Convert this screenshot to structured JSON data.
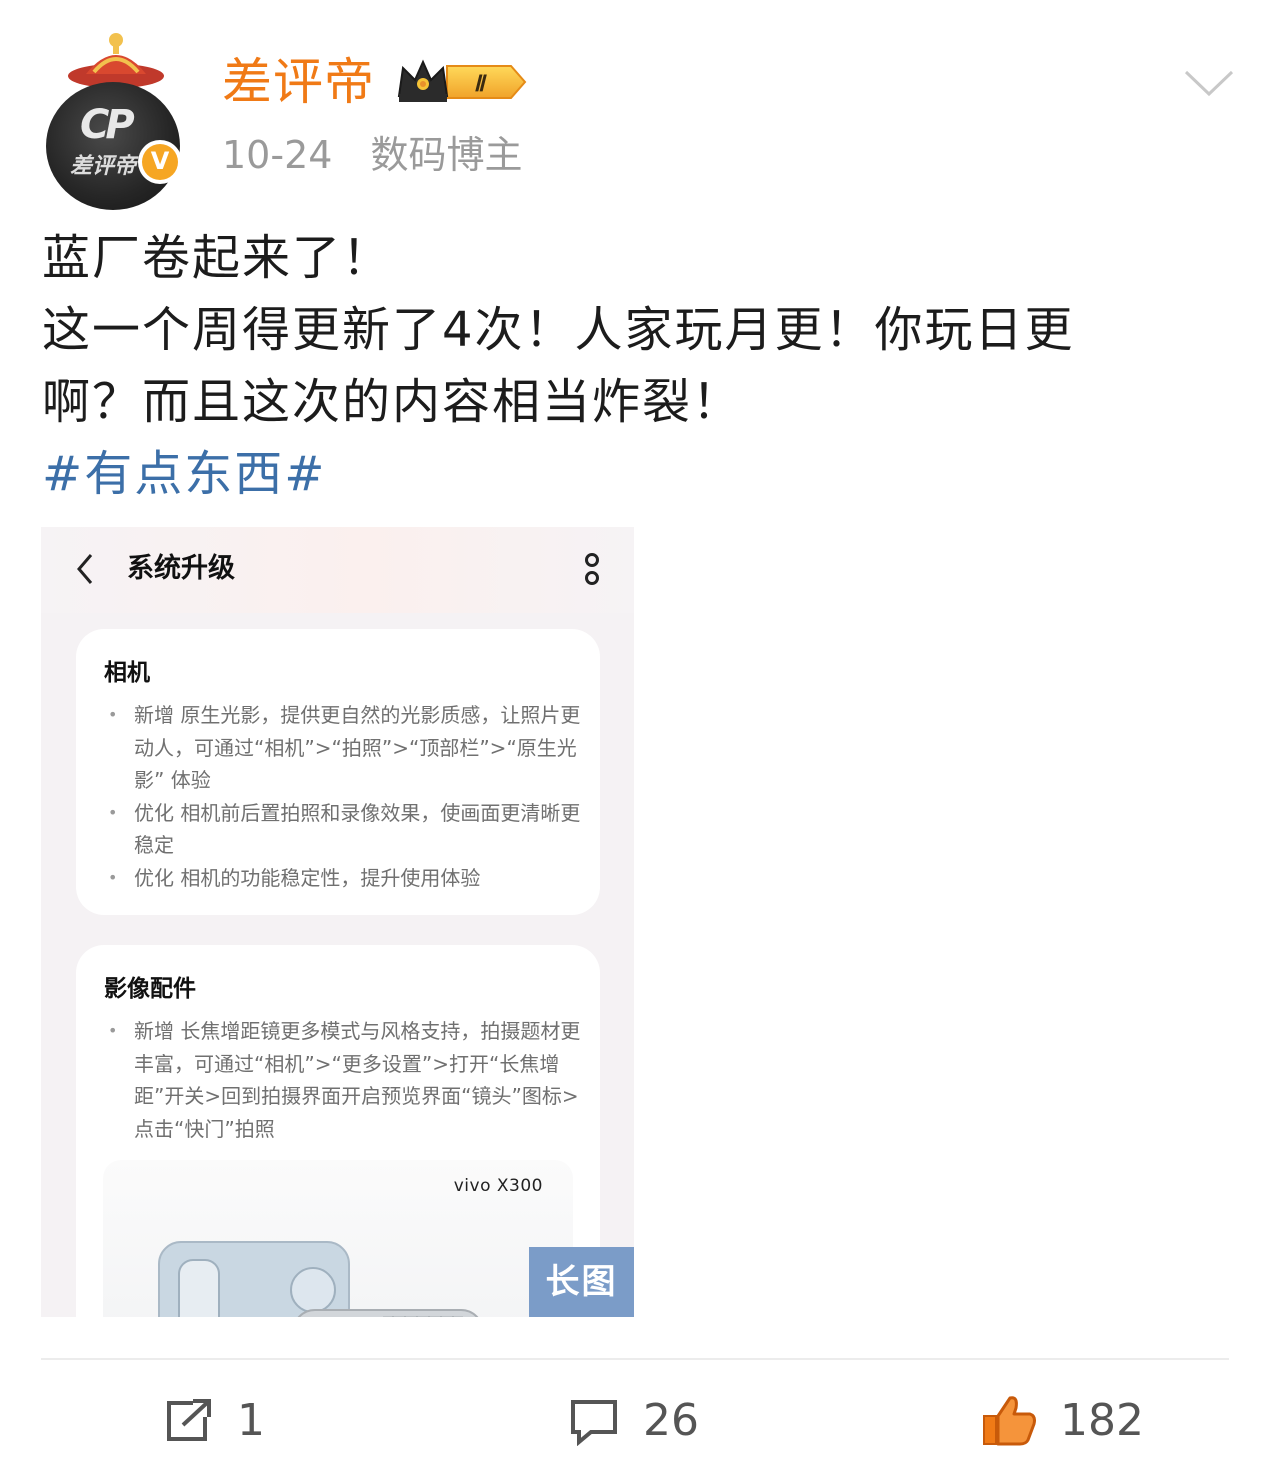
{
  "post": {
    "author": {
      "name": "差评帝",
      "level_badge": "Ⅱ",
      "verified_badge": "V",
      "avatar_logo": "CP",
      "avatar_text": "差评帝"
    },
    "time": "10-24",
    "source": "数码博主",
    "text_lines": [
      "蓝厂卷起来了！",
      "这一个周得更新了4次！人家玩月更！你玩日更",
      "啊？而且这次的内容相当炸裂！"
    ],
    "hashtag": "#有点东西#"
  },
  "media": {
    "screen_title": "系统升级",
    "sections": [
      {
        "title": "相机",
        "items": [
          "新增 原生光影，提供更自然的光影质感，让照片更动人，可通过“相机”>“拍照”>“顶部栏”>“原生光影” 体验",
          "优化 相机前后置拍照和录像效果，使画面更清晰更稳定",
          "优化 相机的功能稳定性，提升使用体验"
        ]
      },
      {
        "title": "影像配件",
        "items": [
          "新增 长焦增距镜更多模式与风格支持，拍摄题材更丰富，可通过“相机”>“更多设置”>打开“长焦增距”开关>回到拍摄界面开启预览界面“镜头”图标>点击“快门”拍照"
        ]
      }
    ],
    "promo_brand": "vivo X300",
    "long_image_tag": "长图"
  },
  "actions": {
    "share_count": "1",
    "comment_count": "26",
    "like_count": "182"
  },
  "icons": {
    "share": "share-icon",
    "comment": "comment-icon",
    "like": "like-icon",
    "dropdown": "chevron-down-icon",
    "back": "back-icon",
    "more": "more-icon",
    "crown": "crown-icon"
  },
  "colors": {
    "username": "#f07a16",
    "hashtag": "#3c6fa8",
    "meta": "#9a9a9a",
    "long_tag_bg": "#7b9cc8",
    "like_icon": "#f07a16"
  }
}
